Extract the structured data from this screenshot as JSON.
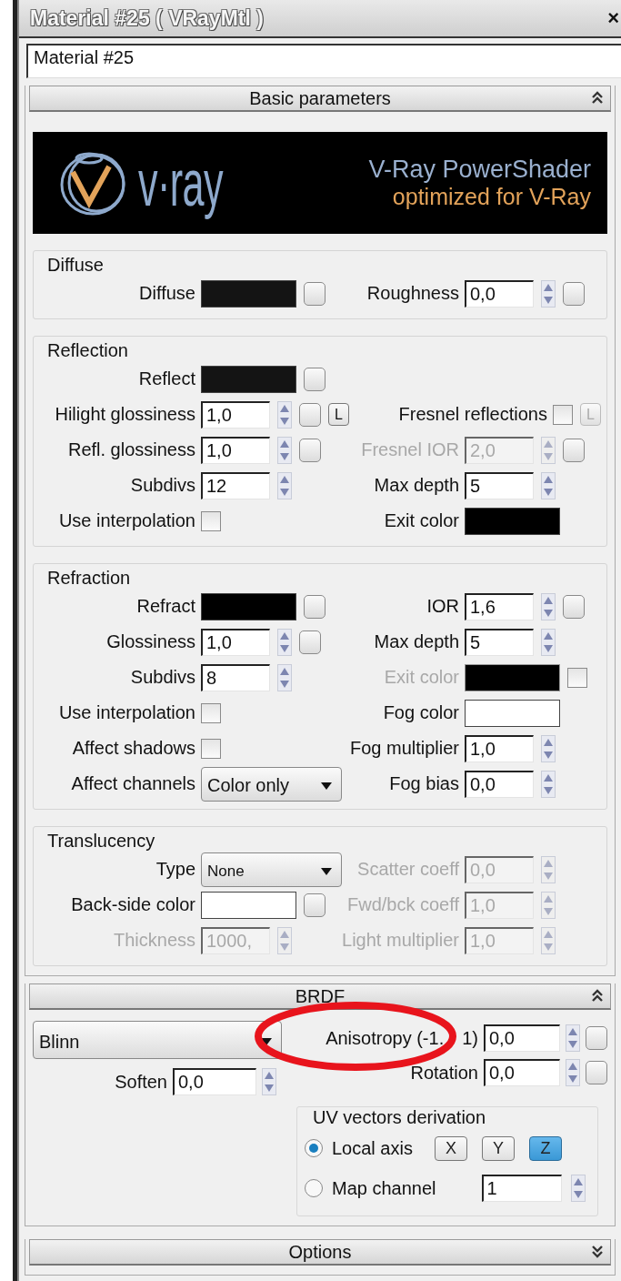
{
  "window": {
    "title": "Material #25  ( VRayMtl )",
    "close": "×"
  },
  "material_name": "Material #25",
  "basic_parameters": {
    "title": "Basic parameters",
    "expanded": true,
    "banner": {
      "logo": "v·ray",
      "title": "V-Ray PowerShader",
      "subtitle": "optimized for V-Ray"
    },
    "groups": [
      {
        "title": "Diffuse",
        "rows": [
          {
            "left": {
              "kind": "color",
              "label": "Diffuse",
              "color": "#141414",
              "map": true
            },
            "right": {
              "kind": "spinner",
              "label": "Roughness",
              "value": "0,0",
              "map": true,
              "disabled": false
            }
          }
        ]
      },
      {
        "title": "Reflection",
        "rows": [
          {
            "left": {
              "kind": "color",
              "label": "Reflect",
              "color": "#141414",
              "map": true
            }
          },
          {
            "left": {
              "kind": "spinner",
              "label": "Hilight glossiness",
              "value": "1,0",
              "map": true,
              "disabled": false,
              "lock": {
                "label": "L",
                "disabled": false
              }
            },
            "right": {
              "kind": "checkbox",
              "label": "Fresnel reflections",
              "checked": false,
              "lock": {
                "label": "L",
                "disabled": true
              }
            }
          },
          {
            "left": {
              "kind": "spinner",
              "label": "Refl. glossiness",
              "value": "1,0",
              "map": true,
              "disabled": false
            },
            "right": {
              "kind": "spinner",
              "label": "Fresnel IOR",
              "value": "2,0",
              "map": true,
              "disabled": true
            }
          },
          {
            "left": {
              "kind": "spinner",
              "label": "Subdivs",
              "value": "12",
              "disabled": false
            },
            "right": {
              "kind": "spinner",
              "label": "Max depth",
              "value": "5",
              "disabled": false
            }
          },
          {
            "left": {
              "kind": "checkbox",
              "label": "Use interpolation",
              "checked": false
            },
            "right": {
              "kind": "color",
              "label": "Exit color",
              "color": "#000000"
            }
          }
        ]
      },
      {
        "title": "Refraction",
        "rows": [
          {
            "left": {
              "kind": "color",
              "label": "Refract",
              "color": "#000000",
              "map": true
            },
            "right": {
              "kind": "spinner",
              "label": "IOR",
              "value": "1,6",
              "map": true,
              "disabled": false
            }
          },
          {
            "left": {
              "kind": "spinner",
              "label": "Glossiness",
              "value": "1,0",
              "map": true,
              "disabled": false
            },
            "right": {
              "kind": "spinner",
              "label": "Max depth",
              "value": "5",
              "disabled": false
            }
          },
          {
            "left": {
              "kind": "spinner",
              "label": "Subdivs",
              "value": "8",
              "disabled": false
            },
            "right": {
              "kind": "color",
              "label": "Exit color",
              "color": "#000000",
              "disabled": true,
              "checkbox": {
                "checked": false
              }
            }
          },
          {
            "left": {
              "kind": "checkbox",
              "label": "Use interpolation",
              "checked": false
            },
            "right": {
              "kind": "color",
              "label": "Fog color",
              "color": "#ffffff"
            }
          },
          {
            "left": {
              "kind": "checkbox",
              "label": "Affect shadows",
              "checked": false
            },
            "right": {
              "kind": "spinner",
              "label": "Fog multiplier",
              "value": "1,0",
              "disabled": false
            }
          },
          {
            "left": {
              "kind": "dropdown",
              "label": "Affect channels",
              "value": "Color only"
            },
            "right": {
              "kind": "spinner",
              "label": "Fog bias",
              "value": "0,0",
              "disabled": false
            }
          }
        ]
      },
      {
        "title": "Translucency",
        "rows": [
          {
            "left": {
              "kind": "dropdown",
              "label": "Type",
              "value": "None"
            },
            "right": {
              "kind": "spinner",
              "label": "Scatter coeff",
              "value": "0,0",
              "disabled": true
            }
          },
          {
            "left": {
              "kind": "color",
              "label": "Back-side color",
              "color": "#ffffff",
              "map": true
            },
            "right": {
              "kind": "spinner",
              "label": "Fwd/bck coeff",
              "value": "1,0",
              "disabled": true
            }
          },
          {
            "left": {
              "kind": "spinner",
              "label": "Thickness",
              "value": "1000,",
              "disabled": true
            },
            "right": {
              "kind": "spinner",
              "label": "Light multiplier",
              "value": "1,0",
              "disabled": true
            }
          }
        ]
      }
    ]
  },
  "brdf": {
    "title": "BRDF",
    "expanded": true,
    "type": "Blinn",
    "soften": {
      "label": "Soften",
      "value": "0,0"
    },
    "params": [
      {
        "label": "Anisotropy (-1.",
        "label_tail": "1)",
        "value": "0,0",
        "map": true
      },
      {
        "label": "Rotation",
        "value": "0,0",
        "map": true
      }
    ],
    "uv": {
      "title": "UV vectors derivation",
      "options": [
        {
          "kind": "axes",
          "label": "Local axis",
          "selected": true,
          "axes": [
            {
              "label": "X",
              "selected": false
            },
            {
              "label": "Y",
              "selected": false
            },
            {
              "label": "Z",
              "selected": true
            }
          ]
        },
        {
          "kind": "channel",
          "label": "Map channel",
          "selected": false,
          "value": "1"
        }
      ]
    },
    "annotation": {
      "kind": "ellipse"
    }
  },
  "options": {
    "title": "Options",
    "expanded": false
  }
}
